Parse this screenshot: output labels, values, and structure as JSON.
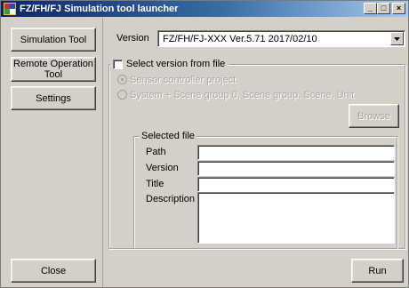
{
  "window": {
    "title": "FZ/FH/FJ Simulation tool launcher",
    "min_glyph": "_",
    "max_glyph": "□",
    "close_glyph": "×"
  },
  "sidebar": {
    "simulation_tool": "Simulation Tool",
    "remote_operation_line1": "Remote Operation",
    "remote_operation_line2": "Tool",
    "settings": "Settings",
    "close": "Close"
  },
  "main": {
    "version_label": "Version",
    "version_value": "FZ/FH/FJ-XXX Ver.5.71 2017/02/10",
    "select_from_file_label": "Select version from file",
    "select_from_file_checked": false,
    "radio_sensor_label": "Sensor controller project",
    "radio_system_label": "System + Scene group 0, Scene group, Scene, Unit",
    "browse": "Browse",
    "selected_file_legend": "Selected file",
    "path_label": "Path",
    "version_field_label": "Version",
    "title_label": "Title",
    "description_label": "Description",
    "path_value": "",
    "version_field_value": "",
    "title_value": "",
    "description_value": "",
    "run": "Run"
  }
}
